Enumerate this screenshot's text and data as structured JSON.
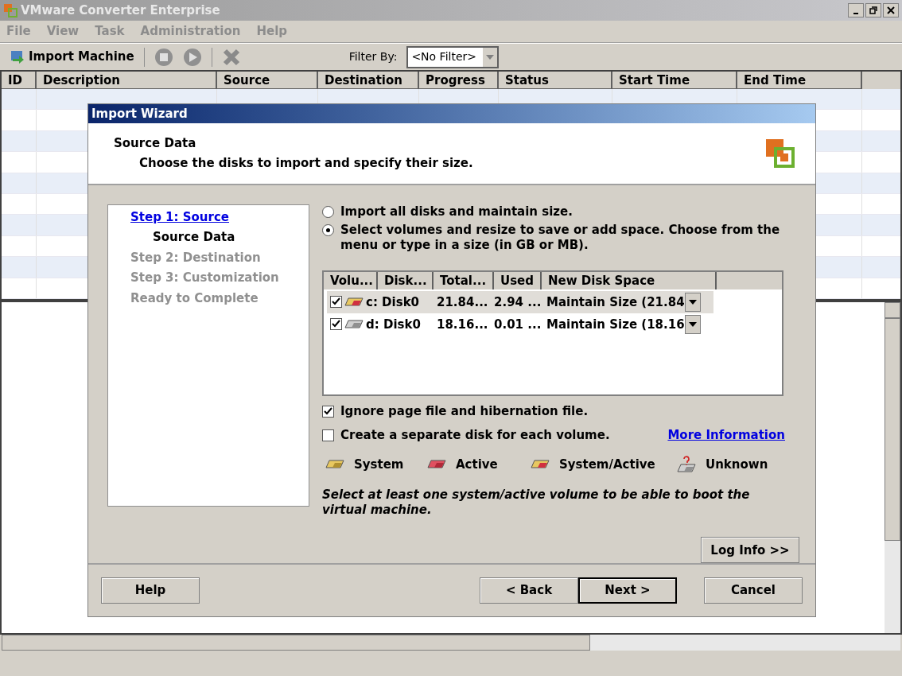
{
  "window": {
    "title": "VMware Converter Enterprise"
  },
  "menu": [
    "File",
    "View",
    "Task",
    "Administration",
    "Help"
  ],
  "toolbar": {
    "import_button": "Import Machine",
    "filter_label": "Filter By:",
    "filter_value": "<No Filter>"
  },
  "table": {
    "columns": [
      "ID",
      "Description",
      "Source",
      "Destination",
      "Progress",
      "Status",
      "Start Time",
      "End Time"
    ]
  },
  "dialog": {
    "title": "Import Wizard",
    "header_title": "Source Data",
    "header_subtitle": "Choose the disks to import and specify their size.",
    "steps": [
      {
        "label": "Step 1: Source",
        "kind": "link",
        "children": [
          {
            "label": "Source Data",
            "kind": "current"
          }
        ]
      },
      {
        "label": "Step 2: Destination",
        "kind": "pending"
      },
      {
        "label": "Step 3: Customization",
        "kind": "pending"
      },
      {
        "label": "Ready to Complete",
        "kind": "pending"
      }
    ],
    "options": [
      {
        "label": "Import all disks and maintain size.",
        "selected": false
      },
      {
        "label": "Select volumes and resize to save or add space. Choose from the menu or type in a size (in GB or MB).",
        "selected": true
      }
    ],
    "volume_table": {
      "columns": [
        "Volu...",
        "Disk...",
        "Total...",
        "Used",
        "New Disk Space"
      ],
      "rows": [
        {
          "checked": true,
          "kind": "system_active",
          "volume": "c: Disk0",
          "total": "21.84...",
          "used": "2.94 ...",
          "new_space": "Maintain Size (21.84",
          "selected": true
        },
        {
          "checked": true,
          "kind": "plain",
          "volume": "d: Disk0",
          "total": "18.16...",
          "used": "0.01 ...",
          "new_space": "Maintain Size (18.16",
          "selected": false
        }
      ]
    },
    "checkboxes": [
      {
        "label": "Ignore page file and hibernation file.",
        "checked": true
      },
      {
        "label": "Create a separate disk for each volume.",
        "checked": false
      }
    ],
    "more_info_link": "More Information",
    "legend": [
      {
        "label": "System",
        "kind": "system"
      },
      {
        "label": "Active",
        "kind": "active"
      },
      {
        "label": "System/Active",
        "kind": "system_active"
      },
      {
        "label": "Unknown",
        "kind": "unknown"
      }
    ],
    "note": "Select at least one system/active volume to be able to boot the virtual machine.",
    "log_button": "Log Info >>",
    "buttons": [
      {
        "label": "Help",
        "kind": "normal"
      },
      {
        "label": "< Back",
        "kind": "normal"
      },
      {
        "label": "Next >",
        "kind": "default"
      },
      {
        "label": "Cancel",
        "kind": "normal"
      }
    ]
  }
}
